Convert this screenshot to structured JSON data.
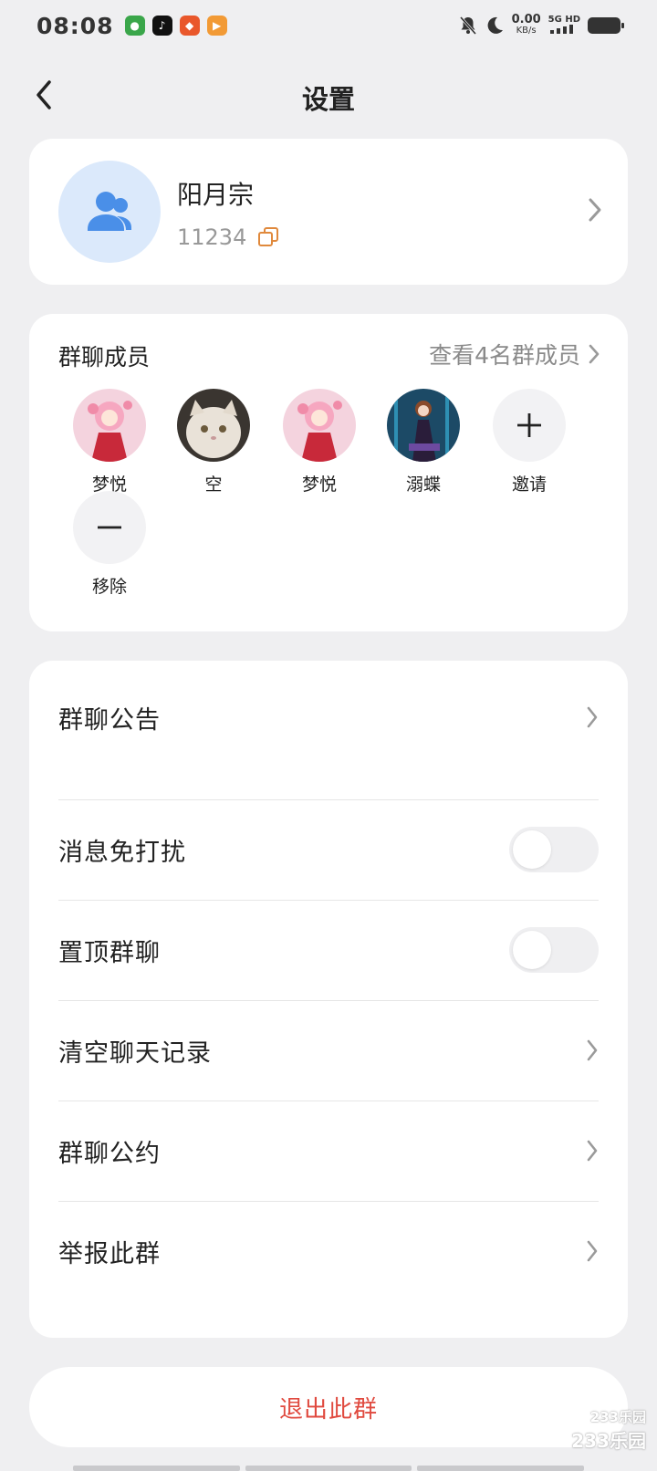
{
  "status_bar": {
    "time": "08:08",
    "net_speed": "0.00",
    "net_unit": "KB/s",
    "signal_label": "5G HD",
    "app_icons": [
      "game-app-icon",
      "tiktok-icon",
      "food-app-icon",
      "video-app-icon"
    ]
  },
  "header": {
    "title": "设置"
  },
  "group": {
    "name": "阳月宗",
    "id": "11234"
  },
  "members_section": {
    "title": "群聊成员",
    "view_all": "查看4名群成员",
    "members": [
      {
        "name": "梦悦",
        "avatar": "anime-girl-avatar"
      },
      {
        "name": "空",
        "avatar": "cat-avatar"
      },
      {
        "name": "梦悦",
        "avatar": "anime-girl-avatar"
      },
      {
        "name": "溺蝶",
        "avatar": "dancer-avatar"
      }
    ],
    "invite_label": "邀请",
    "remove_label": "移除"
  },
  "settings": {
    "announcement": "群聊公告",
    "mute": "消息免打扰",
    "mute_on": false,
    "pin": "置顶群聊",
    "pin_on": false,
    "clear_history": "清空聊天记录",
    "rules": "群聊公约",
    "report": "举报此群"
  },
  "exit_label": "退出此群",
  "watermark": {
    "line1": "233乐园",
    "line2": "233乐园"
  },
  "colors": {
    "accent_blue": "#4a8fe8",
    "danger_red": "#e04a3f",
    "copy_orange": "#e0893c"
  }
}
